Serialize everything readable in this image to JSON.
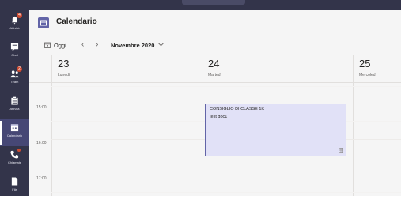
{
  "rail": {
    "items": [
      {
        "label": "Attività",
        "badge": "4",
        "icon": "bell-icon"
      },
      {
        "label": "Chat",
        "icon": "chat-icon"
      },
      {
        "label": "Team",
        "badge": "2",
        "icon": "teams-icon"
      },
      {
        "label": "Attività",
        "icon": "assignments-icon"
      },
      {
        "label": "Calendario",
        "icon": "calendar-icon",
        "active": true
      },
      {
        "label": "Chiamate",
        "icon": "phone-icon"
      },
      {
        "label": "File",
        "icon": "file-icon"
      }
    ]
  },
  "header": {
    "title": "Calendario"
  },
  "toolbar": {
    "today_label": "Oggi",
    "month_label": "Novembre 2020"
  },
  "days": [
    {
      "num": "23",
      "name": "Lunedì"
    },
    {
      "num": "24",
      "name": "Martedì"
    },
    {
      "num": "25",
      "name": "Mercoledì"
    }
  ],
  "times": [
    "15:00",
    "16:00",
    "17:00"
  ],
  "event": {
    "title": "CONSIGLIO DI CLASSE 1K",
    "subtitle": "test doc1"
  },
  "colors": {
    "rail": "#33344a",
    "accent": "#6264a7",
    "event_bg": "#e1e1f7",
    "badge": "#cc4a31"
  }
}
